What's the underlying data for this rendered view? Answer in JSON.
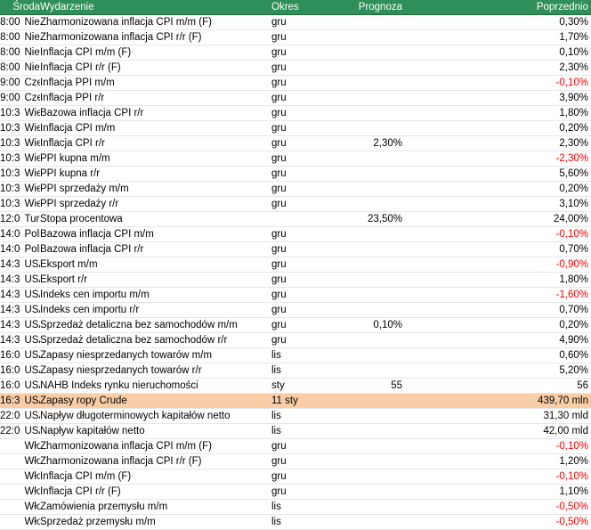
{
  "header": {
    "day": "Środa",
    "event": "Wydarzenie",
    "period": "Okres",
    "forecast": "Prognoza",
    "previous": "Poprzednio"
  },
  "colors": {
    "header_bg": "#2f8f58",
    "highlight_row": "#f9cda6",
    "negative": "#ff0000"
  },
  "rows": [
    {
      "time": "8:00",
      "country": "Niemcy",
      "event": "Zharmonizowana inflacja CPI m/m (F)",
      "period": "gru",
      "forecast": "",
      "previous": "0,30%"
    },
    {
      "time": "8:00",
      "country": "Niemcy",
      "event": "Zharmonizowana inflacja CPI r/r (F)",
      "period": "gru",
      "forecast": "",
      "previous": "1,70%"
    },
    {
      "time": "8:00",
      "country": "Niemcy",
      "event": "Inflacja CPI m/m (F)",
      "period": "gru",
      "forecast": "",
      "previous": "0,10%"
    },
    {
      "time": "8:00",
      "country": "Niemcy",
      "event": "Inflacja CPI r/r (F)",
      "period": "gru",
      "forecast": "",
      "previous": "2,30%"
    },
    {
      "time": "9:00",
      "country": "Czechy",
      "event": "Inflacja PPI m/m",
      "period": "gru",
      "forecast": "",
      "previous": "-0,10%"
    },
    {
      "time": "9:00",
      "country": "Czechy",
      "event": "Inflacja PPI r/r",
      "period": "gru",
      "forecast": "",
      "previous": "3,90%"
    },
    {
      "time": "10:30",
      "country": "Wielka Brytania",
      "event": "Bazowa inflacja CPI r/r",
      "period": "gru",
      "forecast": "",
      "previous": "1,80%"
    },
    {
      "time": "10:30",
      "country": "Wielka Brytania",
      "event": "Inflacja CPI m/m",
      "period": "gru",
      "forecast": "",
      "previous": "0,20%"
    },
    {
      "time": "10:30",
      "country": "Wielka Brytania",
      "event": "Inflacja CPI r/r",
      "period": "gru",
      "forecast": "2,30%",
      "previous": "2,30%"
    },
    {
      "time": "10:30",
      "country": "Wielka Brytania",
      "event": "PPI kupna m/m",
      "period": "gru",
      "forecast": "",
      "previous": "-2,30%"
    },
    {
      "time": "10:30",
      "country": "Wielka Brytania",
      "event": "PPI kupna r/r",
      "period": "gru",
      "forecast": "",
      "previous": "5,60%"
    },
    {
      "time": "10:30",
      "country": "Wielka Brytania",
      "event": "PPI sprzedaży m/m",
      "period": "gru",
      "forecast": "",
      "previous": "0,20%"
    },
    {
      "time": "10:30",
      "country": "Wielka Brytania",
      "event": "PPI sprzedaży r/r",
      "period": "gru",
      "forecast": "",
      "previous": "3,10%"
    },
    {
      "time": "12:00",
      "country": "Turcja",
      "event": "Stopa procentowa",
      "period": "",
      "forecast": "23,50%",
      "previous": "24,00%"
    },
    {
      "time": "14:00",
      "country": "Polska",
      "event": "Bazowa inflacja CPI m/m",
      "period": "gru",
      "forecast": "",
      "previous": "-0,10%"
    },
    {
      "time": "14:00",
      "country": "Polska",
      "event": "Bazowa inflacja CPI r/r",
      "period": "gru",
      "forecast": "",
      "previous": "0,70%"
    },
    {
      "time": "14:30",
      "country": "USA",
      "event": "Eksport m/m",
      "period": "gru",
      "forecast": "",
      "previous": "-0,90%"
    },
    {
      "time": "14:30",
      "country": "USA",
      "event": "Eksport r/r",
      "period": "gru",
      "forecast": "",
      "previous": "1,80%"
    },
    {
      "time": "14:30",
      "country": "USA",
      "event": "Indeks cen importu m/m",
      "period": "gru",
      "forecast": "",
      "previous": "-1,60%"
    },
    {
      "time": "14:30",
      "country": "USA",
      "event": "Indeks cen importu r/r",
      "period": "gru",
      "forecast": "",
      "previous": "0,70%"
    },
    {
      "time": "14:30",
      "country": "USA",
      "event": "Sprzedaż detaliczna bez samochodów m/m",
      "period": "gru",
      "forecast": "0,10%",
      "previous": "0,20%"
    },
    {
      "time": "14:30",
      "country": "USA",
      "event": "Sprzedaż detaliczna bez samochodów r/r",
      "period": "gru",
      "forecast": "",
      "previous": "4,90%"
    },
    {
      "time": "16:00",
      "country": "USA",
      "event": "Zapasy niesprzedanych towarów m/m",
      "period": "lis",
      "forecast": "",
      "previous": "0,60%"
    },
    {
      "time": "16:00",
      "country": "USA",
      "event": "Zapasy niesprzedanych towarów r/r",
      "period": "lis",
      "forecast": "",
      "previous": "5,20%"
    },
    {
      "time": "16:00",
      "country": "USA",
      "event": "NAHB Indeks rynku nieruchomości",
      "period": "sty",
      "forecast": "55",
      "previous": "56"
    },
    {
      "time": "16:30",
      "country": "USA",
      "event": "Zapasy ropy Crude",
      "period": "11 sty",
      "forecast": "",
      "previous": "439,70 mln",
      "highlight": true
    },
    {
      "time": "22:00",
      "country": "USA",
      "event": "Napływ długoterminowych kapitałów netto",
      "period": "lis",
      "forecast": "",
      "previous": "31,30 mld"
    },
    {
      "time": "22:00",
      "country": "USA",
      "event": "Napływ kapitałów netto",
      "period": "lis",
      "forecast": "",
      "previous": "42,00 mld"
    },
    {
      "time": "",
      "country": "Włochy",
      "event": "Zharmonizowana inflacja CPI m/m (F)",
      "period": "gru",
      "forecast": "",
      "previous": "-0,10%"
    },
    {
      "time": "",
      "country": "Włochy",
      "event": "Zharmonizowana inflacja CPI r/r (F)",
      "period": "gru",
      "forecast": "",
      "previous": "1,20%"
    },
    {
      "time": "",
      "country": "Włochy",
      "event": "Inflacja CPI m/m (F)",
      "period": "gru",
      "forecast": "",
      "previous": "-0,10%"
    },
    {
      "time": "",
      "country": "Włochy",
      "event": "Inflacja CPI r/r (F)",
      "period": "gru",
      "forecast": "",
      "previous": "1,10%"
    },
    {
      "time": "",
      "country": "Włochy",
      "event": "Zamówienia przemysłu m/m",
      "period": "lis",
      "forecast": "",
      "previous": "-0,50%"
    },
    {
      "time": "",
      "country": "Włochy",
      "event": "Sprzedaż przemysłu m/m",
      "period": "lis",
      "forecast": "",
      "previous": "-0,50%"
    }
  ]
}
